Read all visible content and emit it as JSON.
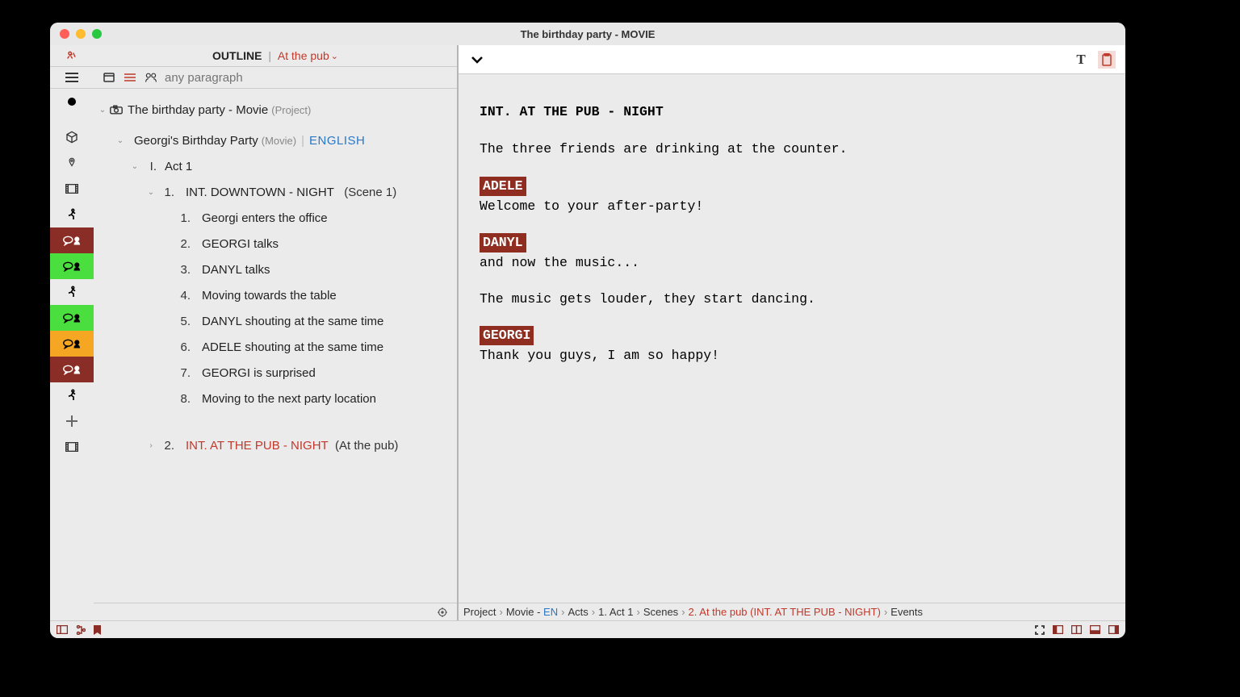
{
  "window": {
    "title": "The birthday party - MOVIE"
  },
  "outline_header": {
    "label": "OUTLINE",
    "scene": "At the pub"
  },
  "filter": {
    "placeholder": "any paragraph"
  },
  "project": {
    "title": "The birthday party - Movie",
    "type_label": "(Project)",
    "movie_title": "Georgi's Birthday Party",
    "movie_type_label": "(Movie)",
    "language": "ENGLISH",
    "acts": [
      {
        "roman": "I.",
        "title": "Act 1",
        "scenes": [
          {
            "num": "1.",
            "slug": "INT.  DOWNTOWN - NIGHT",
            "label": "(Scene 1)",
            "events": [
              {
                "num": "1.",
                "text": "Georgi enters the office"
              },
              {
                "num": "2.",
                "text": "GEORGI talks"
              },
              {
                "num": "3.",
                "text": "DANYL talks"
              },
              {
                "num": "4.",
                "text": "Moving towards the table"
              },
              {
                "num": "5.",
                "text": "DANYL shouting at the same time"
              },
              {
                "num": "6.",
                "text": "ADELE shouting at the same time"
              },
              {
                "num": "7.",
                "text": "GEORGI is surprised"
              },
              {
                "num": "8.",
                "text": "Moving to the next party location"
              }
            ]
          },
          {
            "num": "2.",
            "slug": "INT.  AT THE PUB - NIGHT",
            "label": "(At the pub)",
            "active": true
          }
        ]
      }
    ]
  },
  "script": {
    "slug": "INT. AT THE PUB - NIGHT",
    "lines": [
      {
        "type": "action",
        "text": "The three friends are drinking at the counter."
      },
      {
        "type": "cue",
        "speaker": "ADELE",
        "text": "Welcome to your after-party!"
      },
      {
        "type": "cue",
        "speaker": "DANYL",
        "text": "and now the music..."
      },
      {
        "type": "action",
        "text": "The music gets louder, they start dancing."
      },
      {
        "type": "cue",
        "speaker": "GEORGI",
        "text": "Thank you guys, I am so happy!"
      }
    ]
  },
  "breadcrumb": {
    "p0": "Project",
    "p1": "Movie - ",
    "p1b": "EN",
    "p2": "Acts",
    "p3": "1. Act 1",
    "p4": "Scenes",
    "p5": "2. At the pub (INT.  AT THE PUB - NIGHT)",
    "p6": "Events"
  }
}
